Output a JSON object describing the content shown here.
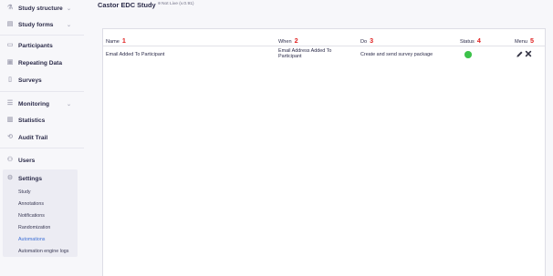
{
  "sidebar": {
    "items": [
      {
        "label": "Study structure",
        "icon": "structure-icon",
        "chevron": "chevron-down-icon"
      },
      {
        "label": "Study forms",
        "icon": "form-icon",
        "chevron": "chevron-down-icon"
      },
      {
        "label": "Participants",
        "icon": "folder-icon"
      },
      {
        "label": "Repeating Data",
        "icon": "repeat-icon"
      },
      {
        "label": "Surveys",
        "icon": "survey-icon"
      },
      {
        "label": "Monitoring",
        "icon": "monitoring-icon",
        "chevron": "chevron-down-icon"
      },
      {
        "label": "Statistics",
        "icon": "chart-icon"
      },
      {
        "label": "Audit Trail",
        "icon": "audit-icon"
      },
      {
        "label": "Users",
        "icon": "users-icon"
      },
      {
        "label": "Settings",
        "icon": "gear-icon"
      }
    ],
    "settings_sub": [
      "Study",
      "Annotations",
      "Notifications",
      "Randomization",
      "Automations",
      "Automation engine logs"
    ],
    "active_sub": "Automations"
  },
  "header": {
    "study_name": "Castor EDC Study",
    "status": "Not Live (v.0.91)"
  },
  "table": {
    "columns": [
      {
        "label": "Name",
        "num": "1"
      },
      {
        "label": "When",
        "num": "2"
      },
      {
        "label": "Do",
        "num": "3"
      },
      {
        "label": "Status",
        "num": "4"
      },
      {
        "label": "Menu",
        "num": "5"
      }
    ],
    "rows": [
      {
        "name": "Email Added To Participant",
        "when_line1": "Email Address Added To",
        "when_line2": "Participant",
        "do": "Create and send survey package",
        "status": "active",
        "status_color": "#3cc24a"
      }
    ]
  },
  "colors": {
    "accent": "#3c6fd6",
    "marker": "#e02020",
    "status_active": "#3cc24a"
  }
}
